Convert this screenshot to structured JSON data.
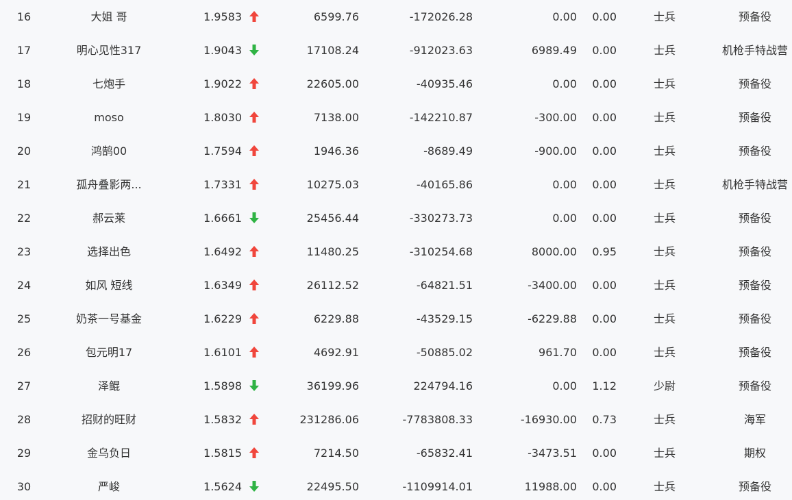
{
  "colors": {
    "up": "#f0463c",
    "down": "#2fb344",
    "text": "#333333",
    "background": "#f7f8fa"
  },
  "rows": [
    {
      "rank": "16",
      "name": "大姐 哥",
      "score": "1.9583",
      "trend": "up",
      "v1": "6599.76",
      "v2": "-172026.28",
      "v3": "0.00",
      "v4": "0.00",
      "military_rank": "士兵",
      "team": "预备役"
    },
    {
      "rank": "17",
      "name": "明心见性317",
      "score": "1.9043",
      "trend": "down",
      "v1": "17108.24",
      "v2": "-912023.63",
      "v3": "6989.49",
      "v4": "0.00",
      "military_rank": "士兵",
      "team": "机枪手特战营"
    },
    {
      "rank": "18",
      "name": "七炮手",
      "score": "1.9022",
      "trend": "up",
      "v1": "22605.00",
      "v2": "-40935.46",
      "v3": "0.00",
      "v4": "0.00",
      "military_rank": "士兵",
      "team": "预备役"
    },
    {
      "rank": "19",
      "name": "moso",
      "score": "1.8030",
      "trend": "up",
      "v1": "7138.00",
      "v2": "-142210.87",
      "v3": "-300.00",
      "v4": "0.00",
      "military_rank": "士兵",
      "team": "预备役"
    },
    {
      "rank": "20",
      "name": "鸿鹄00",
      "score": "1.7594",
      "trend": "up",
      "v1": "1946.36",
      "v2": "-8689.49",
      "v3": "-900.00",
      "v4": "0.00",
      "military_rank": "士兵",
      "team": "预备役"
    },
    {
      "rank": "21",
      "name": "孤舟叠影两...",
      "score": "1.7331",
      "trend": "up",
      "v1": "10275.03",
      "v2": "-40165.86",
      "v3": "0.00",
      "v4": "0.00",
      "military_rank": "士兵",
      "team": "机枪手特战营"
    },
    {
      "rank": "22",
      "name": "郝云莱",
      "score": "1.6661",
      "trend": "down",
      "v1": "25456.44",
      "v2": "-330273.73",
      "v3": "0.00",
      "v4": "0.00",
      "military_rank": "士兵",
      "team": "预备役"
    },
    {
      "rank": "23",
      "name": "选择出色",
      "score": "1.6492",
      "trend": "up",
      "v1": "11480.25",
      "v2": "-310254.68",
      "v3": "8000.00",
      "v4": "0.95",
      "military_rank": "士兵",
      "team": "预备役"
    },
    {
      "rank": "24",
      "name": "如风 短线",
      "score": "1.6349",
      "trend": "up",
      "v1": "26112.52",
      "v2": "-64821.51",
      "v3": "-3400.00",
      "v4": "0.00",
      "military_rank": "士兵",
      "team": "预备役"
    },
    {
      "rank": "25",
      "name": "奶茶一号基金",
      "score": "1.6229",
      "trend": "up",
      "v1": "6229.88",
      "v2": "-43529.15",
      "v3": "-6229.88",
      "v4": "0.00",
      "military_rank": "士兵",
      "team": "预备役"
    },
    {
      "rank": "26",
      "name": "包元明17",
      "score": "1.6101",
      "trend": "up",
      "v1": "4692.91",
      "v2": "-50885.02",
      "v3": "961.70",
      "v4": "0.00",
      "military_rank": "士兵",
      "team": "预备役"
    },
    {
      "rank": "27",
      "name": "泽鲲",
      "score": "1.5898",
      "trend": "down",
      "v1": "36199.96",
      "v2": "224794.16",
      "v3": "0.00",
      "v4": "1.12",
      "military_rank": "少尉",
      "team": "预备役"
    },
    {
      "rank": "28",
      "name": "招财的旺财",
      "score": "1.5832",
      "trend": "up",
      "v1": "231286.06",
      "v2": "-7783808.33",
      "v3": "-16930.00",
      "v4": "0.73",
      "military_rank": "士兵",
      "team": "海军"
    },
    {
      "rank": "29",
      "name": "金乌负日",
      "score": "1.5815",
      "trend": "up",
      "v1": "7214.50",
      "v2": "-65832.41",
      "v3": "-3473.51",
      "v4": "0.00",
      "military_rank": "士兵",
      "team": "期权"
    },
    {
      "rank": "30",
      "name": "严峻",
      "score": "1.5624",
      "trend": "down",
      "v1": "22495.50",
      "v2": "-1109914.01",
      "v3": "11988.00",
      "v4": "0.00",
      "military_rank": "士兵",
      "team": "预备役"
    }
  ]
}
